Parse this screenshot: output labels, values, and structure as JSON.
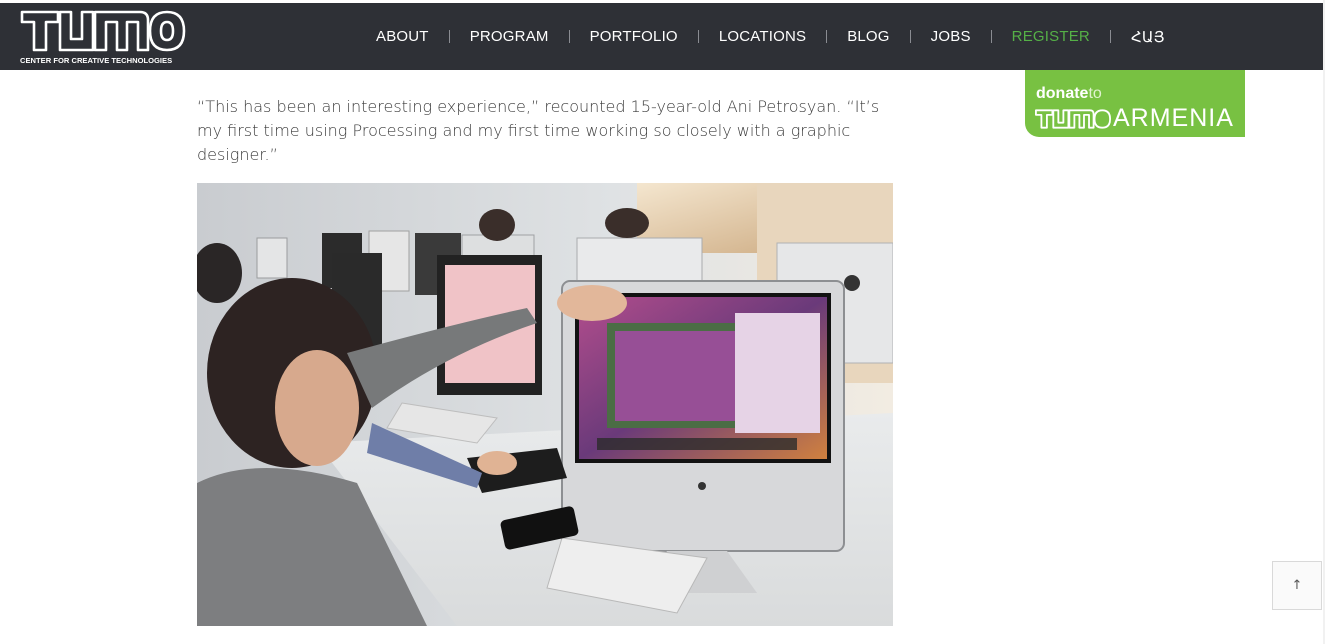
{
  "brand": {
    "logo_text": "TUMO",
    "tagline": "CENTER FOR CREATIVE TECHNOLOGIES"
  },
  "nav": {
    "items": [
      {
        "label": "ABOUT"
      },
      {
        "label": "PROGRAM"
      },
      {
        "label": "PORTFOLIO"
      },
      {
        "label": "LOCATIONS"
      },
      {
        "label": "BLOG"
      },
      {
        "label": "JOBS"
      },
      {
        "label": "REGISTER"
      },
      {
        "label": "ՀԱՅ"
      }
    ],
    "colors": {
      "background": "#2e3036",
      "text": "#ffffff",
      "highlight": "#55b047"
    }
  },
  "sidebar": {
    "donate": {
      "word_donate": "donate",
      "word_to": "to",
      "brand": "TUMO",
      "location": "ARMENIA",
      "color": "#78c142"
    }
  },
  "article": {
    "quote": "“This has been an interesting experience,” recounted 15-year-old Ani Petrosyan. “It’s my first time using Processing and my first time working so closely with a graphic designer.”"
  },
  "controls": {
    "back_to_top_icon": "arrow-up-icon",
    "back_to_top_glyph": "↑"
  }
}
